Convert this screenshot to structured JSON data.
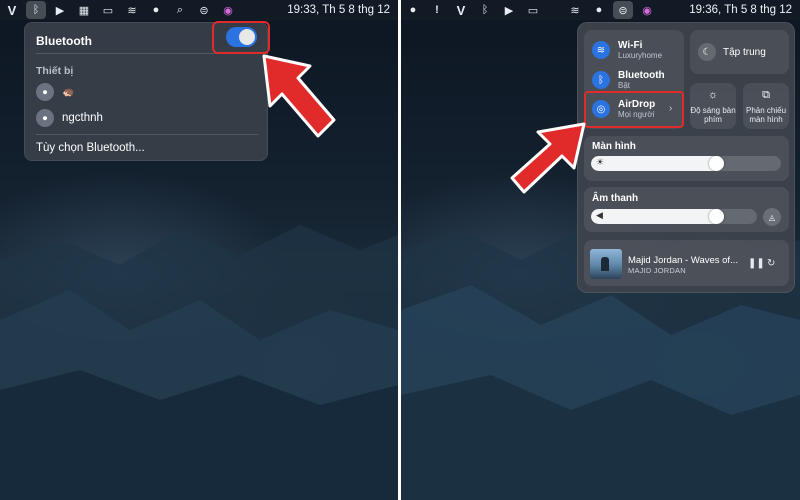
{
  "left": {
    "menubar": {
      "icons": [
        "v-app-icon",
        "bluetooth-icon",
        "play-icon",
        "calendar-icon",
        "battery-icon",
        "wifi-icon",
        "user-icon",
        "search-icon",
        "control-center-icon",
        "siri-icon"
      ],
      "clock": "19:33, Th 5 8 thg 12"
    },
    "bluetooth_menu": {
      "title": "Bluetooth",
      "toggle_on": true,
      "section": "Thiết bị",
      "devices": [
        {
          "name": "",
          "icon": "airpods-icon",
          "badge": "🦔"
        },
        {
          "name": "ngcthnh",
          "icon": "airpods-icon"
        }
      ],
      "options_label": "Tùy chọn Bluetooth..."
    }
  },
  "right": {
    "menubar": {
      "icons": [
        "apple-icon",
        "alert-icon",
        "v-app-icon",
        "bluetooth-icon",
        "play-icon",
        "battery-icon",
        "wifi-icon",
        "control-center-icon",
        "siri-icon"
      ],
      "clock": "19:36, Th 5 8 thg 12"
    },
    "control_center": {
      "wifi": {
        "title": "Wi-Fi",
        "subtitle": "Luxuryhome"
      },
      "bluetooth": {
        "title": "Bluetooth",
        "subtitle": "Bật"
      },
      "airdrop": {
        "title": "AirDrop",
        "subtitle": "Mọi người"
      },
      "focus": {
        "label": "Tập trung"
      },
      "keyboard_brightness": {
        "label": "Độ sáng bàn phím"
      },
      "screen_mirroring": {
        "label": "Phản chiếu màn hình"
      },
      "display": {
        "label": "Màn hình",
        "level": 0.7
      },
      "sound": {
        "label": "Âm thanh",
        "level": 0.8
      },
      "now_playing": {
        "title": "Majid Jordan - Waves of...",
        "artist": "MAJID JORDAN"
      }
    }
  },
  "colors": {
    "accent": "#2b73e0",
    "highlight": "#e12a2a"
  }
}
